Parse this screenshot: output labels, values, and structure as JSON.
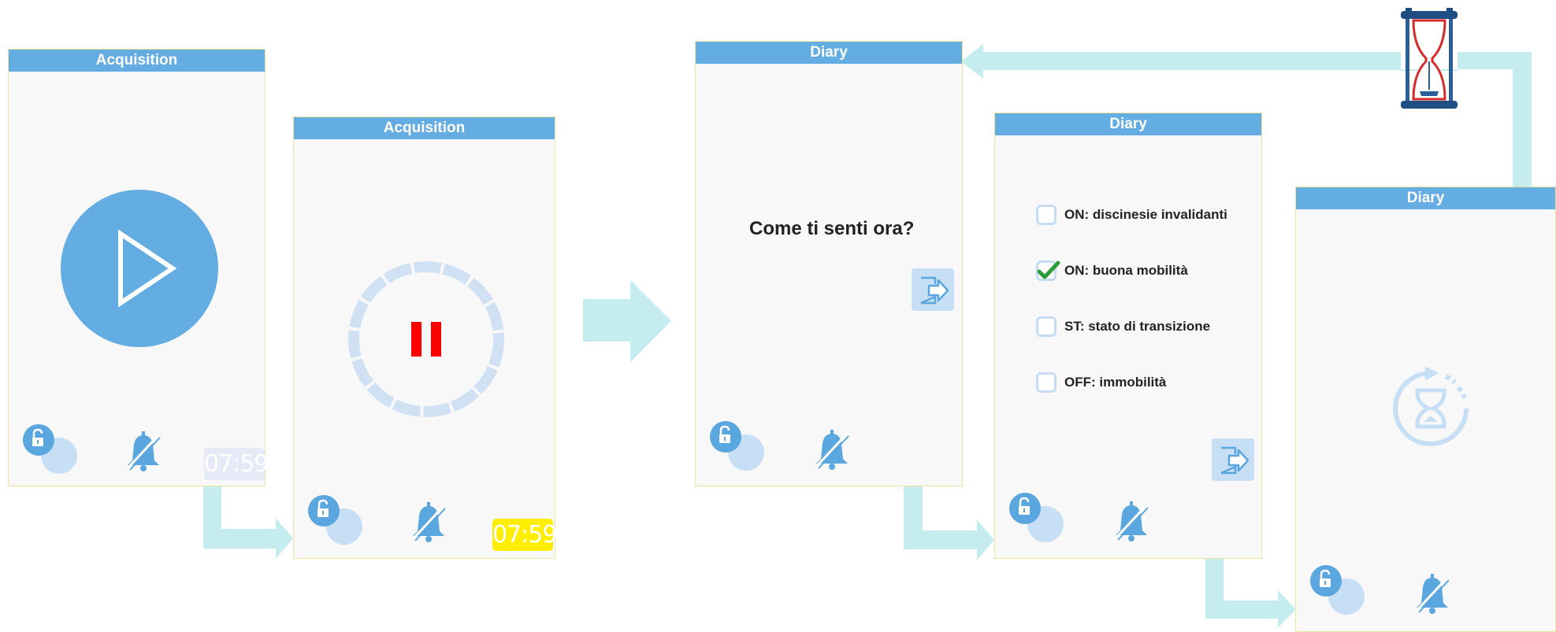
{
  "colors": {
    "header": "#64ade2",
    "arrow": "#c5ecef",
    "accent_blue": "#64ade2",
    "pause_red": "#ff0000",
    "badge_yellow": "#ffee00",
    "check_green": "#2e9b3a"
  },
  "screens": {
    "acq1": {
      "title": "Acquisition",
      "time": "07:59",
      "main_icon": "play-icon"
    },
    "acq2": {
      "title": "Acquisition",
      "time": "07:59",
      "main_icon": "pause-icon"
    },
    "diary1": {
      "title": "Diary",
      "question": "Come ti senti ora?",
      "action_icon": "exit-icon"
    },
    "diary2": {
      "title": "Diary",
      "options": [
        {
          "label": "ON: discinesie invalidanti",
          "checked": false
        },
        {
          "label": "ON: buona mobilità",
          "checked": true
        },
        {
          "label": "ST: stato di transizione",
          "checked": false
        },
        {
          "label": "OFF: immobilità",
          "checked": false
        }
      ],
      "action_icon": "exit-icon"
    },
    "diary3": {
      "title": "Diary",
      "main_icon": "hourglass-timer-icon"
    }
  },
  "icons": {
    "lock": "lock-toggle-icon",
    "bell": "bell-off-icon",
    "timer": "hourglass-icon"
  }
}
